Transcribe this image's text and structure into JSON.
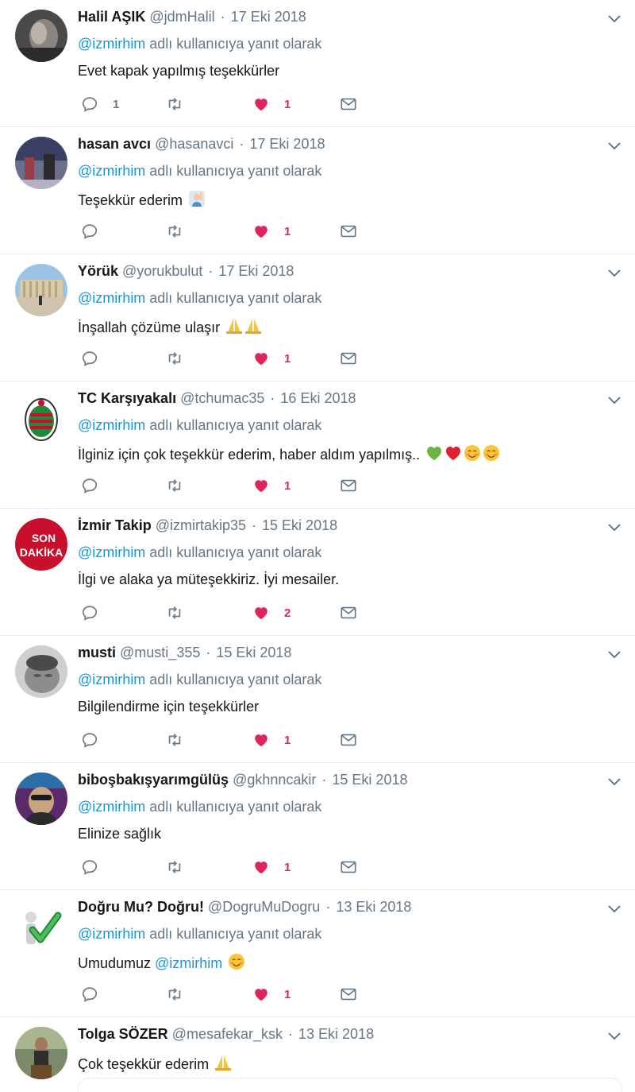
{
  "reply_prefix": "adlı kullanıcıya yanıt olarak",
  "colors": {
    "link": "#1b95e0",
    "muted": "#657786",
    "like": "#e0245e",
    "border": "#e6ecf0"
  },
  "tweets": [
    {
      "name": "Halil AŞIK",
      "handle": "@jdmHalil",
      "date": "17 Eki 2018",
      "reply_to": "@izmirhim",
      "text": "Evet kapak yapılmış teşekkürler",
      "replies": "1",
      "likes": "1"
    },
    {
      "name": "hasan avcı",
      "handle": "@hasanavci",
      "date": "17 Eki 2018",
      "reply_to": "@izmirhim",
      "text": "Teşekkür ederim",
      "emoji": [
        "person-raising-hand-emoji"
      ],
      "replies": "",
      "likes": "1"
    },
    {
      "name": "Yörük",
      "handle": "@yorukbulut",
      "date": "17 Eki 2018",
      "reply_to": "@izmirhim",
      "text": "İnşallah çözüme ulaşır",
      "emoji": [
        "folded-hands-emoji",
        "folded-hands-emoji"
      ],
      "replies": "",
      "likes": "1"
    },
    {
      "name": "TC Karşıyakalı",
      "handle": "@tchumac35",
      "date": "16 Eki 2018",
      "reply_to": "@izmirhim",
      "text": "İlginiz için çok teşekkür ederim, haber aldım yapılmış..",
      "emoji": [
        "green-heart-emoji",
        "red-heart-emoji",
        "smiling-face-emoji",
        "smiling-face-emoji"
      ],
      "replies": "",
      "likes": "1"
    },
    {
      "name": "İzmir Takip",
      "handle": "@izmirtakip35",
      "date": "15 Eki 2018",
      "reply_to": "@izmirhim",
      "text": "İlgi ve alaka ya müteşekkiriz. İyi mesailer.",
      "replies": "",
      "likes": "2",
      "avatar_text": [
        "SON",
        "DAKİKA"
      ]
    },
    {
      "name": "musti",
      "handle": "@musti_355",
      "date": "15 Eki 2018",
      "reply_to": "@izmirhim",
      "text": "Bilgilendirme için teşekkürler",
      "replies": "",
      "likes": "1"
    },
    {
      "name": "biboşbakışyarımgülüş",
      "handle": "@gkhnncakir",
      "date": "15 Eki 2018",
      "reply_to": "@izmirhim",
      "text": "Elinize sağlık",
      "replies": "",
      "likes": "1"
    },
    {
      "name": "Doğru Mu? Doğru!",
      "handle": "@DogruMuDogru",
      "date": "13 Eki 2018",
      "reply_to": "@izmirhim",
      "text_prefix": "Umudumuz ",
      "text_mention": "@izmirhim",
      "emoji": [
        "smiling-face-emoji"
      ],
      "replies": "",
      "likes": "1"
    },
    {
      "name": "Tolga SÖZER",
      "handle": "@mesafekar_ksk",
      "date": "13 Eki 2018",
      "text": "Çok teşekkür ederim",
      "emoji": [
        "folded-hands-emoji"
      ]
    }
  ]
}
